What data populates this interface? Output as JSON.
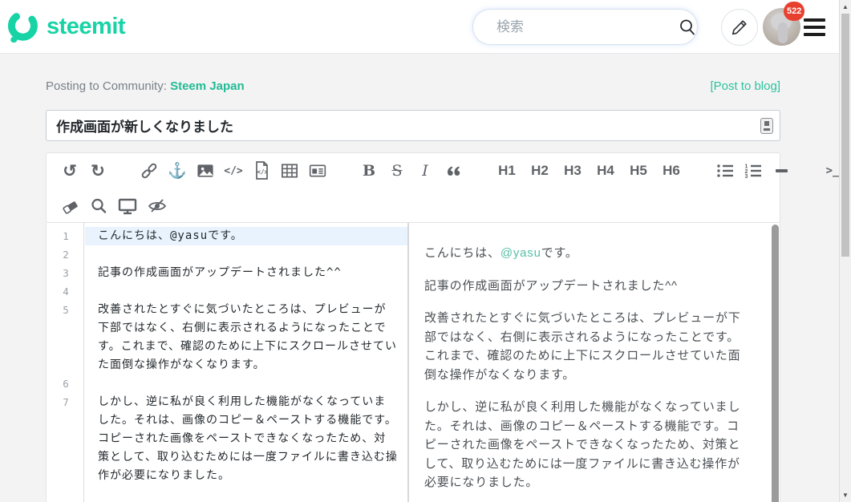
{
  "colors": {
    "brand_teal": "#18d3a6",
    "link_teal": "#22bb94",
    "mention_teal": "#55bfa5",
    "badge_red": "#e8402f",
    "active_line_blue": "#e8f3fd"
  },
  "header": {
    "logo_text": "steemit",
    "search_placeholder": "検索",
    "notification_count": "522"
  },
  "post_meta": {
    "posting_label": "Posting to Community:",
    "community": "Steem Japan",
    "post_to_blog_label": "[Post to blog]"
  },
  "title_input": {
    "value": "作成画面が新しくなりました"
  },
  "toolbar": {
    "undo_glyph": "↺",
    "redo_glyph": "↻",
    "anchor_glyph": "⚓",
    "inline_code_label": "</>",
    "bold_label": "B",
    "strike_label": "S",
    "italic_label": "I",
    "h1": "H1",
    "h2": "H2",
    "h3": "H3",
    "h4": "H4",
    "h5": "H5",
    "h6": "H6",
    "terminal_label": ">_"
  },
  "editor": {
    "lines": [
      {
        "num": "1",
        "text": "こんにちは、@yasuです。"
      },
      {
        "num": "2",
        "text": ""
      },
      {
        "num": "3",
        "text": "記事の作成画面がアップデートされました^^"
      },
      {
        "num": "4",
        "text": ""
      },
      {
        "num": "5",
        "text": "改善されたとすぐに気づいたところは、プレビューが下部ではなく、右側に表示されるようになったことです。これまで、確認のために上下にスクロールさせていた面倒な操作がなくなります。"
      },
      {
        "num": "6",
        "text": ""
      },
      {
        "num": "7",
        "text": "しかし、逆に私が良く利用した機能がなくなっていました。それは、画像のコピー＆ペーストする機能です。コピーされた画像をペーストできなくなったため、対策として、取り込むためには一度ファイルに書き込む操作が必要になりました。"
      }
    ]
  },
  "preview": {
    "p1_prefix": "こんにちは、",
    "p1_mention": "@yasu",
    "p1_suffix": "です。",
    "p2": "記事の作成画面がアップデートされました^^",
    "p3": "改善されたとすぐに気づいたところは、プレビューが下部ではなく、右側に表示されるようになったことです。これまで、確認のために上下にスクロールさせていた面倒な操作がなくなります。",
    "p4": "しかし、逆に私が良く利用した機能がなくなっていました。それは、画像のコピー＆ペーストする機能です。コピーされた画像をペーストできなくなったため、対策として、取り込むためには一度ファイルに書き込む操作が必要になりました。"
  }
}
